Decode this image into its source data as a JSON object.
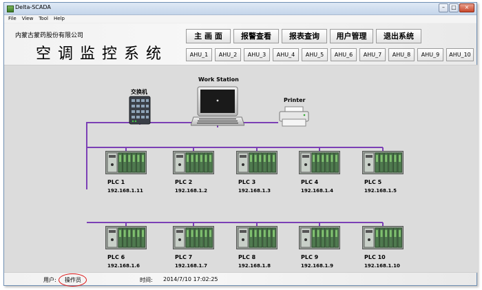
{
  "window": {
    "title": "Delta-SCADA"
  },
  "menu": [
    "File",
    "View",
    "Tool",
    "Help"
  ],
  "header": {
    "company": "内蒙古蒙药股份有限公司",
    "system_title": "空调监控系统"
  },
  "nav_buttons": [
    "主 画 面",
    "报警查看",
    "报表查询",
    "用户管理",
    "退出系统"
  ],
  "ahu_buttons": [
    "AHU_1",
    "AHU_2",
    "AHU_3",
    "AHU_4",
    "AHU_5",
    "AHU_6",
    "AHU_7",
    "AHU_8",
    "AHU_9",
    "AHU_10"
  ],
  "network": {
    "switch_label": "交换机",
    "workstation_label": "Work Station",
    "printer_label": "Printer",
    "link_color": "#7b3fb5",
    "plcs": [
      {
        "name": "PLC 1",
        "ip": "192.168.1.11"
      },
      {
        "name": "PLC 2",
        "ip": "192.168.1.2"
      },
      {
        "name": "PLC 3",
        "ip": "192.168.1.3"
      },
      {
        "name": "PLC 4",
        "ip": "192.168.1.4"
      },
      {
        "name": "PLC 5",
        "ip": "192.168.1.5"
      },
      {
        "name": "PLC 6",
        "ip": "192.168.1.6"
      },
      {
        "name": "PLC 7",
        "ip": "192.168.1.7"
      },
      {
        "name": "PLC 8",
        "ip": "192.168.1.8"
      },
      {
        "name": "PLC 9",
        "ip": "192.168.1.9"
      },
      {
        "name": "PLC 10",
        "ip": "192.168.1.10"
      }
    ]
  },
  "status_bar": {
    "user_label": "用户:",
    "user_value": "操作员",
    "time_label": "时间:",
    "time_value": "2014/7/10 17:02:25"
  }
}
